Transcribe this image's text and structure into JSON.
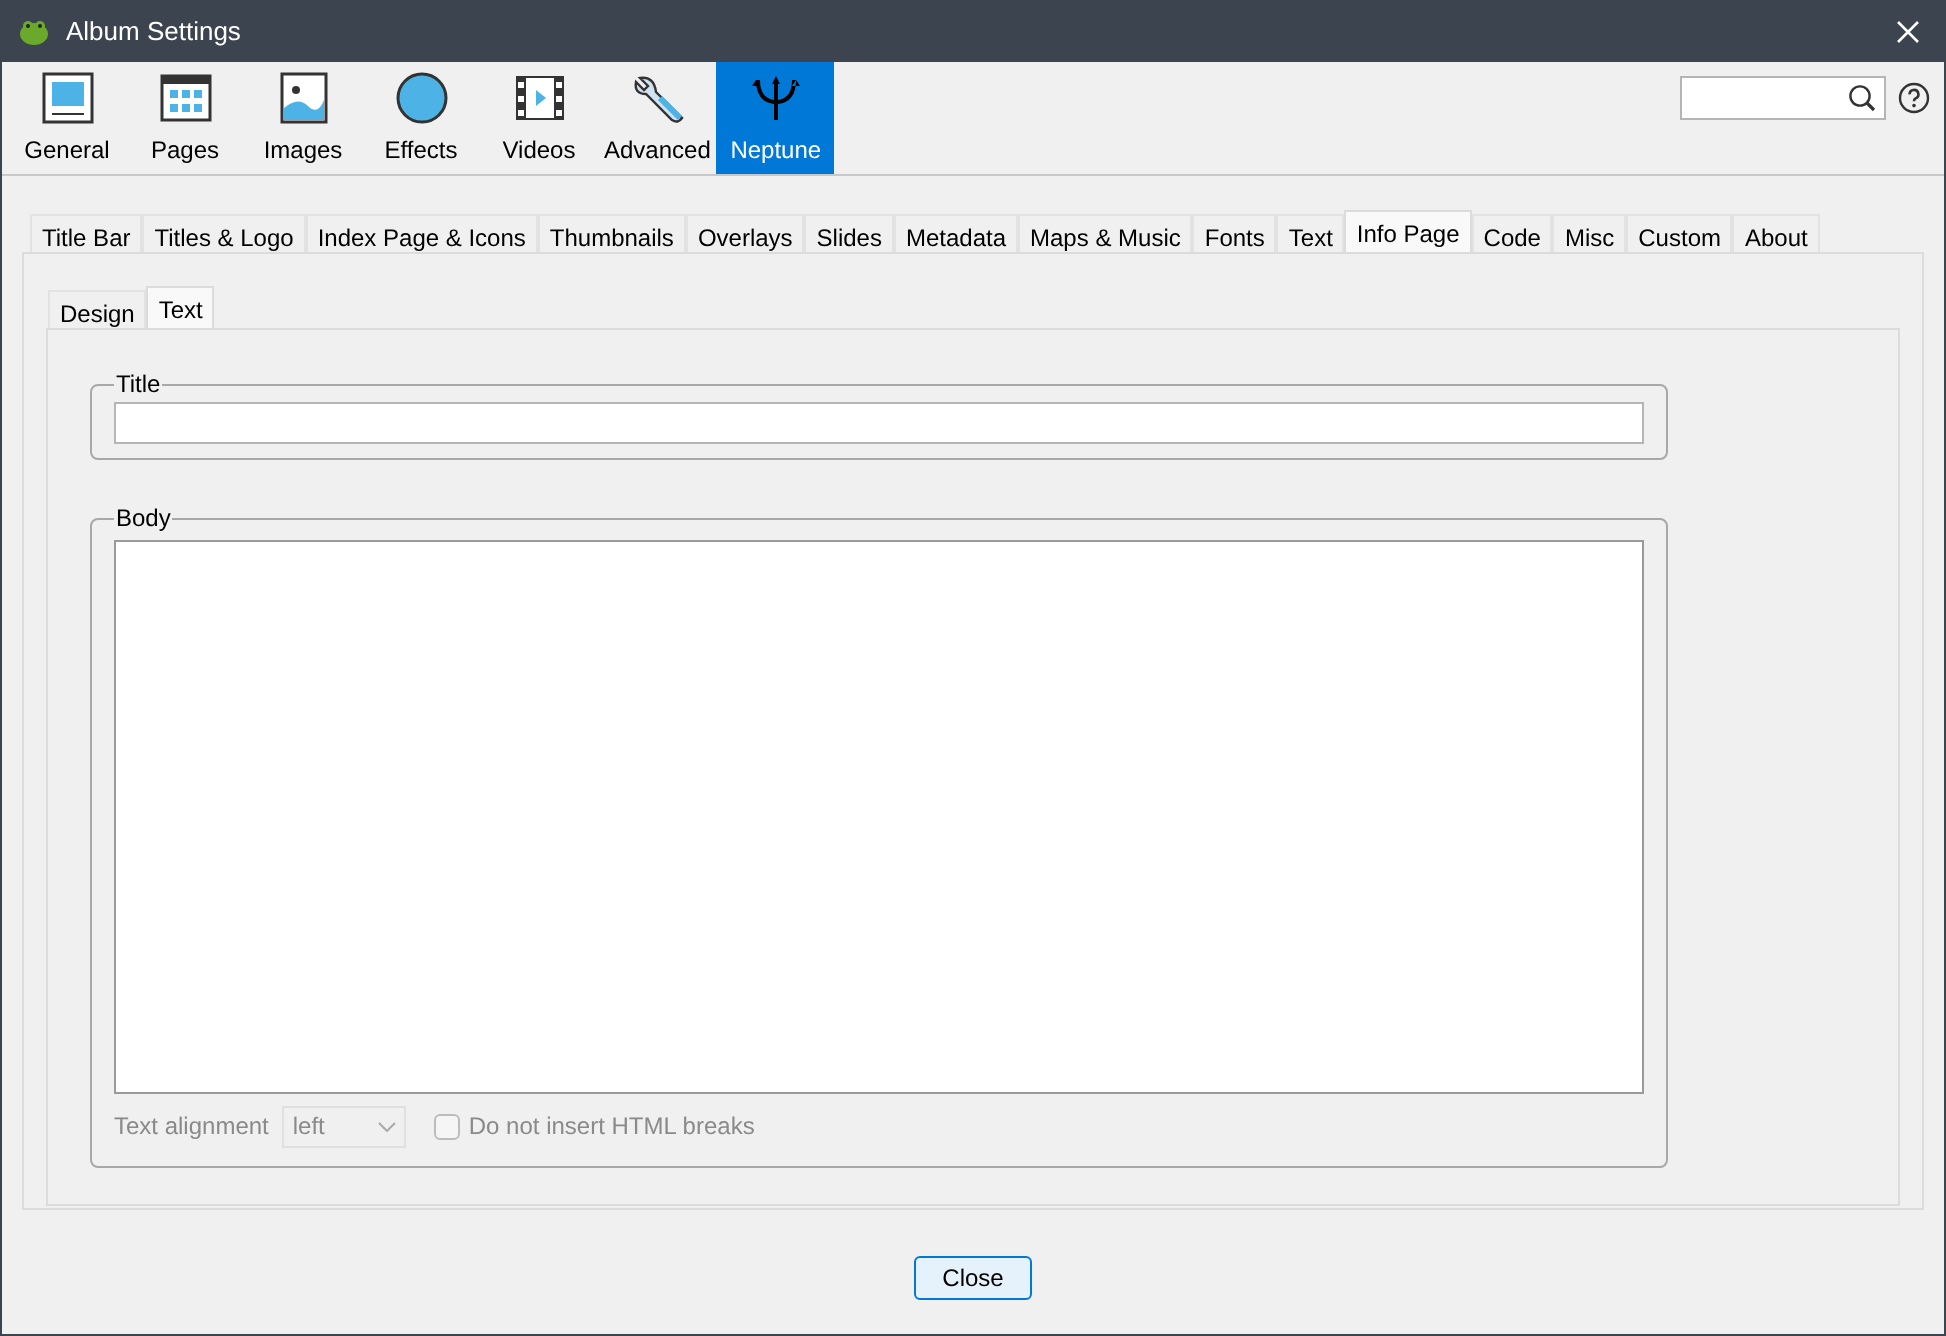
{
  "window": {
    "title": "Album Settings"
  },
  "toolbar": [
    {
      "label": "General",
      "selected": false
    },
    {
      "label": "Pages",
      "selected": false
    },
    {
      "label": "Images",
      "selected": false
    },
    {
      "label": "Effects",
      "selected": false
    },
    {
      "label": "Videos",
      "selected": false
    },
    {
      "label": "Advanced",
      "selected": false
    },
    {
      "label": "Neptune",
      "selected": true
    }
  ],
  "tabs": [
    {
      "label": "Title Bar",
      "selected": false
    },
    {
      "label": "Titles & Logo",
      "selected": false
    },
    {
      "label": "Index Page & Icons",
      "selected": false
    },
    {
      "label": "Thumbnails",
      "selected": false
    },
    {
      "label": "Overlays",
      "selected": false
    },
    {
      "label": "Slides",
      "selected": false
    },
    {
      "label": "Metadata",
      "selected": false
    },
    {
      "label": "Maps & Music",
      "selected": false
    },
    {
      "label": "Fonts",
      "selected": false
    },
    {
      "label": "Text",
      "selected": false
    },
    {
      "label": "Info Page",
      "selected": true
    },
    {
      "label": "Code",
      "selected": false
    },
    {
      "label": "Misc",
      "selected": false
    },
    {
      "label": "Custom",
      "selected": false
    },
    {
      "label": "About",
      "selected": false
    }
  ],
  "subtabs": [
    {
      "label": "Design",
      "selected": false
    },
    {
      "label": "Text",
      "selected": true
    }
  ],
  "title_group": {
    "legend": "Title"
  },
  "body_group": {
    "legend": "Body",
    "alignment_label": "Text alignment",
    "alignment": {
      "value": "left",
      "disabled": true
    },
    "no_breaks": {
      "label": "Do not insert HTML breaks",
      "checked": false,
      "disabled": true
    }
  },
  "close_button": "Close"
}
